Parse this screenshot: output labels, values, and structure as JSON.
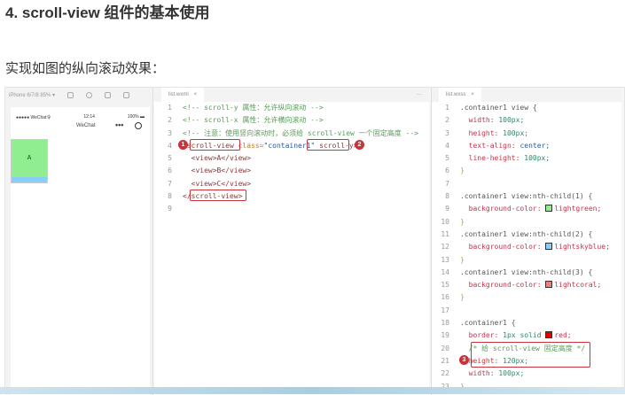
{
  "heading": "4. scroll-view 组件的基本使用",
  "subheading": "实现如图的纵向滚动效果：",
  "simulator": {
    "device": "iPhone 6/7/8 85% ▾",
    "carrier": "●●●●● WeChat令",
    "time": "12:14",
    "battery": "100% ▬",
    "nav_title": "WeChat",
    "menu": "•••",
    "view_a": "A"
  },
  "editor1": {
    "tab": "list.wxml",
    "close": "×",
    "more": "···",
    "lines": [
      [
        {
          "t": "<!-- scroll-y 属性：允许纵向滚动 -->",
          "c": "#5a9a5a"
        }
      ],
      [
        {
          "t": "<!-- scroll-x 属性：允许横向滚动 -->",
          "c": "#5a9a5a"
        }
      ],
      [
        {
          "t": "<!-- 注意：使用竖向滚动时，必须给 scroll-view 一个固定高度 -->",
          "c": "#5a9a5a"
        }
      ],
      [
        {
          "t": "<scroll-view",
          "c": "#8a3a3a"
        },
        {
          "t": " class=",
          "c": "#c07a30"
        },
        {
          "t": "\"container1\"",
          "c": "#2a5aa0"
        },
        {
          "t": " scroll-y>",
          "c": "#8a3a3a"
        }
      ],
      [
        {
          "t": "  <view>A</view>",
          "c": "#8a3a3a"
        }
      ],
      [
        {
          "t": "  <view>B</view>",
          "c": "#8a3a3a"
        }
      ],
      [
        {
          "t": "  <view>C</view>",
          "c": "#8a3a3a"
        }
      ],
      [
        {
          "t": "</scroll-view>",
          "c": "#8a3a3a"
        }
      ],
      [
        {
          "t": "",
          "c": "#333"
        }
      ]
    ]
  },
  "editor2": {
    "tab": "list.wxss",
    "close": "×",
    "lines": [
      [
        {
          "t": ".container1 view {",
          "c": "#555"
        }
      ],
      [
        {
          "t": "  width: ",
          "c": "#c0354a"
        },
        {
          "t": "100px;",
          "c": "#2a8a6a"
        }
      ],
      [
        {
          "t": "  height: ",
          "c": "#c0354a"
        },
        {
          "t": "100px;",
          "c": "#2a8a6a"
        }
      ],
      [
        {
          "t": "  text-align: ",
          "c": "#c0354a"
        },
        {
          "t": "center;",
          "c": "#2a5aa0"
        }
      ],
      [
        {
          "t": "  line-height: ",
          "c": "#c0354a"
        },
        {
          "t": "100px;",
          "c": "#2a8a6a"
        }
      ],
      [
        {
          "t": "}",
          "c": "#c0a040"
        }
      ],
      [
        {
          "t": "",
          "c": "#333"
        }
      ],
      [
        {
          "t": ".container1 view:nth-child(1) {",
          "c": "#555"
        }
      ],
      [
        {
          "t": "  background-color: ",
          "c": "#c0354a"
        },
        {
          "sw": "#90ee90"
        },
        {
          "t": "lightgreen;",
          "c": "#c0354a"
        }
      ],
      [
        {
          "t": "}",
          "c": "#c0a040"
        }
      ],
      [
        {
          "t": ".container1 view:nth-child(2) {",
          "c": "#555"
        }
      ],
      [
        {
          "t": "  background-color: ",
          "c": "#c0354a"
        },
        {
          "sw": "#87cefa"
        },
        {
          "t": "lightskyblue;",
          "c": "#c0354a"
        }
      ],
      [
        {
          "t": "}",
          "c": "#c0a040"
        }
      ],
      [
        {
          "t": ".container1 view:nth-child(3) {",
          "c": "#555"
        }
      ],
      [
        {
          "t": "  background-color: ",
          "c": "#c0354a"
        },
        {
          "sw": "#f08080"
        },
        {
          "t": "lightcoral;",
          "c": "#c0354a"
        }
      ],
      [
        {
          "t": "}",
          "c": "#c0a040"
        }
      ],
      [
        {
          "t": "",
          "c": "#333"
        }
      ],
      [
        {
          "t": ".container1 {",
          "c": "#555"
        }
      ],
      [
        {
          "t": "  border: ",
          "c": "#c0354a"
        },
        {
          "t": "1px solid ",
          "c": "#2a8a6a"
        },
        {
          "sw": "#e00000"
        },
        {
          "t": "red;",
          "c": "#c0354a"
        }
      ],
      [
        {
          "t": "  /* 给 scroll-view 固定高度 */",
          "c": "#5a9a5a"
        }
      ],
      [
        {
          "t": "  height: ",
          "c": "#c0354a"
        },
        {
          "t": "120px;",
          "c": "#2a8a6a"
        }
      ],
      [
        {
          "t": "  width: ",
          "c": "#c0354a"
        },
        {
          "t": "100px;",
          "c": "#2a8a6a"
        }
      ],
      [
        {
          "t": "}",
          "c": "#c0a040"
        }
      ]
    ]
  },
  "badges": [
    "1",
    "2",
    "3"
  ]
}
